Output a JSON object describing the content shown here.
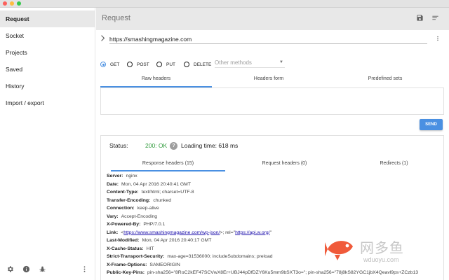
{
  "sidebar": {
    "items": [
      {
        "label": "Request",
        "active": true
      },
      {
        "label": "Socket"
      },
      {
        "label": "Projects"
      },
      {
        "label": "Saved"
      },
      {
        "label": "History"
      },
      {
        "label": "Import / export"
      }
    ],
    "footer_icons": [
      "gear-icon",
      "info-icon",
      "bug-icon",
      "more-vert-icon"
    ]
  },
  "header": {
    "title": "Request",
    "icons": [
      "save-icon",
      "sort-icon"
    ]
  },
  "url": {
    "value": "https://smashingmagazine.com"
  },
  "methods": {
    "options": [
      "GET",
      "POST",
      "PUT",
      "DELETE"
    ],
    "selected": "GET",
    "other_placeholder": "Other methods"
  },
  "request_tabs": [
    "Raw headers",
    "Headers form",
    "Predefined sets"
  ],
  "send_label": "SEND",
  "response": {
    "status_label": "Status:",
    "status_value": "200: OK",
    "loading_time": "Loading time: 618 ms",
    "tabs": [
      "Response headers (15)",
      "Request headers (0)",
      "Redirects (1)"
    ],
    "headers": [
      {
        "key": "Server:",
        "value": "nginx"
      },
      {
        "key": "Date:",
        "value": "Mon, 04 Apr 2016 20:40:41 GMT"
      },
      {
        "key": "Content-Type:",
        "value": "text/html; charset=UTF-8"
      },
      {
        "key": "Transfer-Encoding:",
        "value": "chunked"
      },
      {
        "key": "Connection:",
        "value": "keep-alive"
      },
      {
        "key": "Vary:",
        "value": "Accept-Encoding"
      },
      {
        "key": "X-Powered-By:",
        "value": "PHP/7.0.1"
      },
      {
        "key": "Link:",
        "value_prefix": "<",
        "link1": "https://www.smashingmagazine.com/wp-json/",
        "value_middle": ">; rel=\"",
        "link2": "https://api.w.org/",
        "value_suffix": "\""
      },
      {
        "key": "Last-Modified:",
        "value": "Mon, 04 Apr 2016 20:40:17 GMT"
      },
      {
        "key": "X-Cache-Status:",
        "value": "HIT"
      },
      {
        "key": "Strict-Transport-Security:",
        "value": "max-age=31536000; includeSubdomains; preload"
      },
      {
        "key": "X-Frame-Options:",
        "value": "SAMEORIGIN"
      },
      {
        "key": "Public-Key-Pins:",
        "value": "pin-sha256=\"8RoC2kEF47SCVwX8Er+UBJ44pDfDZY6Ku5mm9bSXT3o=\"; pin-sha256=\"78j8kS82YGC1jbX4Qeavl9ps+ZCzb13"
      }
    ]
  },
  "watermark": {
    "cn": "网多鱼",
    "url": "wduoyu.com"
  },
  "colors": {
    "accent": "#4a90e2",
    "status_ok": "#2e9a3a",
    "header_bg": "#e8e8e8"
  }
}
